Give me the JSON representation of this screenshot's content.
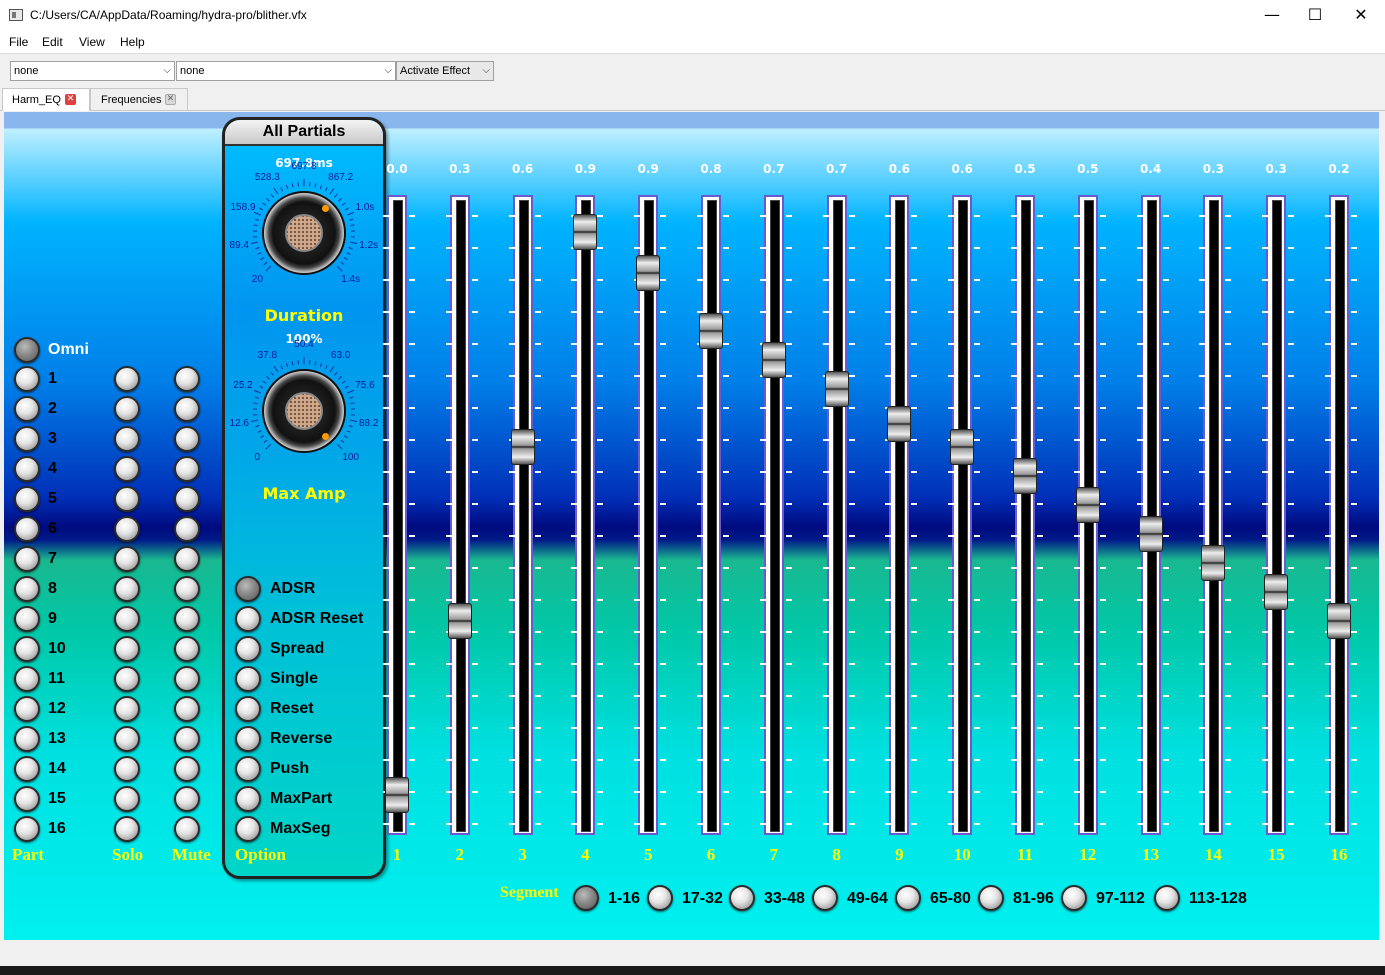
{
  "window": {
    "title": "C:/Users/CA/AppData/Roaming/hydra-pro/blither.vfx",
    "minimize": "—",
    "maximize": "☐",
    "close": "✕"
  },
  "menu": [
    "File",
    "Edit",
    "View",
    "Help"
  ],
  "toolbar": {
    "combo1": "none",
    "combo2": "none",
    "effect": "Activate Effect"
  },
  "tabs": [
    {
      "label": "Harm_EQ",
      "active": true
    },
    {
      "label": "Frequencies",
      "active": false
    }
  ],
  "parts": {
    "omni_label": "Omni",
    "numbers": [
      "1",
      "2",
      "3",
      "4",
      "5",
      "6",
      "7",
      "8",
      "9",
      "10",
      "11",
      "12",
      "13",
      "14",
      "15",
      "16"
    ],
    "part_label": "Part",
    "solo_label": "Solo",
    "mute_label": "Mute"
  },
  "panel": {
    "title": "All Partials",
    "duration": {
      "value": "697.8ms",
      "title": "Duration",
      "ticks": [
        "20",
        "89.4",
        "158.9",
        "528.3",
        "697.8",
        "867.2",
        "1.0s",
        "1.2s",
        "1.4s"
      ]
    },
    "max_amp": {
      "value": "100%",
      "title": "Max Amp",
      "ticks": [
        "0",
        "12.6",
        "25.2",
        "37.8",
        "50.4",
        "63.0",
        "75.6",
        "88.2",
        "100"
      ]
    },
    "option_label": "Option",
    "options": [
      "ADSR",
      "ADSR Reset",
      "Spread",
      "Single",
      "Reset",
      "Reverse",
      "Push",
      "MaxPart",
      "MaxSeg"
    ]
  },
  "sliders": {
    "values": [
      "0.0",
      "0.3",
      "0.6",
      "0.9",
      "0.9",
      "0.8",
      "0.7",
      "0.7",
      "0.6",
      "0.6",
      "0.5",
      "0.5",
      "0.4",
      "0.3",
      "0.3",
      "0.2"
    ],
    "levels": [
      0.0,
      0.3,
      0.6,
      0.97,
      0.9,
      0.8,
      0.75,
      0.7,
      0.64,
      0.6,
      0.55,
      0.5,
      0.45,
      0.4,
      0.35,
      0.3
    ],
    "labels": [
      "1",
      "2",
      "3",
      "4",
      "5",
      "6",
      "7",
      "8",
      "9",
      "10",
      "11",
      "12",
      "13",
      "14",
      "15",
      "16"
    ]
  },
  "segments": {
    "label": "Segment",
    "items": [
      "1-16",
      "17-32",
      "33-48",
      "49-64",
      "65-80",
      "81-96",
      "97-112",
      "113-128"
    ]
  }
}
